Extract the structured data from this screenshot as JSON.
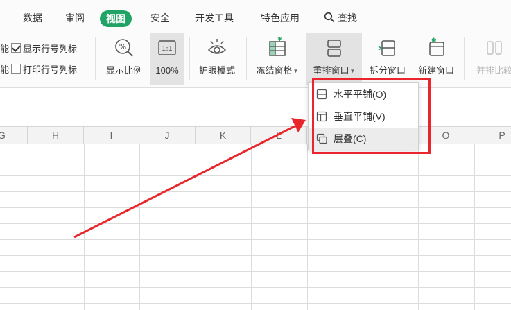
{
  "menu": {
    "items": [
      "数据",
      "审阅",
      "视图",
      "安全",
      "开发工具",
      "特色应用"
    ],
    "active": "视图",
    "search_label": "查找"
  },
  "toolbar": {
    "show_headers_label": "显示行号列标",
    "print_headers_label": "打印行号列标",
    "cut_fragment": "能",
    "show_ratio_label": "显示比例",
    "zoom_100_label": "100%",
    "zoom_100_icon_text": "1:1",
    "eye_mode_label": "护眼模式",
    "freeze_panes_label": "冻结窗格",
    "arrange_windows_label": "重排窗口",
    "split_window_label": "拆分窗口",
    "new_window_label": "新建窗口",
    "side_by_side_label": "并排比较"
  },
  "dropdown": {
    "items": [
      {
        "label": "水平平铺(O)",
        "icon": "horizontal-tile-icon"
      },
      {
        "label": "垂直平铺(V)",
        "icon": "vertical-tile-icon"
      },
      {
        "label": "层叠(C)",
        "icon": "cascade-icon"
      }
    ],
    "hovered": "层叠(C)"
  },
  "columns": [
    "G",
    "H",
    "I",
    "J",
    "K",
    "L",
    "M",
    "N",
    "O",
    "P"
  ],
  "colors": {
    "accent": "#21a366",
    "annotation_red": "#e8262b",
    "icon_gray": "#555555"
  }
}
